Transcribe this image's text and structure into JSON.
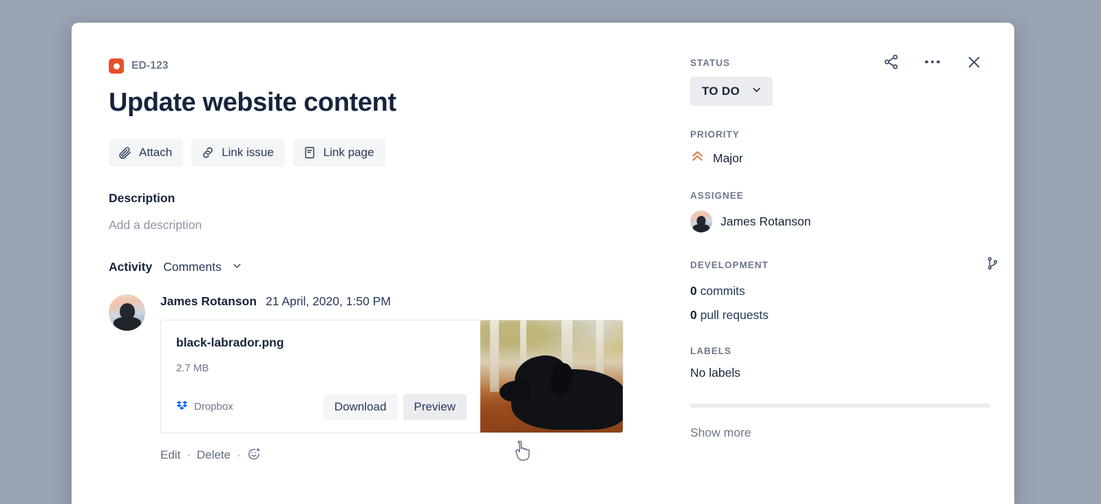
{
  "issue": {
    "key": "ED-123",
    "title": "Update website content",
    "project_icon": "project-square-icon",
    "accent_color": "#e8502a"
  },
  "top_actions": {
    "share_label": "share-icon",
    "more_label": "more-options-icon",
    "close_label": "close-icon"
  },
  "action_buttons": [
    {
      "label": "Attach",
      "icon": "paperclip-icon"
    },
    {
      "label": "Link issue",
      "icon": "link-icon"
    },
    {
      "label": "Link page",
      "icon": "page-icon"
    }
  ],
  "description": {
    "heading": "Description",
    "placeholder": "Add a description"
  },
  "activity": {
    "heading": "Activity",
    "tab_label": "Comments",
    "chevron": "chevron-down-icon"
  },
  "comment": {
    "author": "James Rotanson",
    "timestamp": "21 April, 2020, 1:50 PM",
    "actions": {
      "edit": "Edit",
      "separator": "·",
      "delete": "Delete",
      "emoji": "add-reaction-icon"
    },
    "attachment": {
      "filename": "black-labrador.png",
      "size": "2.7 MB",
      "source": "Dropbox",
      "source_icon": "dropbox-icon",
      "source_color": "#0061fe",
      "download_label": "Download",
      "preview_label": "Preview",
      "thumbnail_alt": "black labrador dog lying in autumn leaves"
    }
  },
  "sidebar": {
    "status": {
      "label": "STATUS",
      "value": "TO DO",
      "chevron": "chevron-down-icon"
    },
    "priority": {
      "label": "PRIORITY",
      "value": "Major",
      "icon": "priority-major-icon",
      "icon_color": "#d97440"
    },
    "assignee": {
      "label": "ASSIGNEE",
      "value": "James Rotanson",
      "avatar": "user-avatar"
    },
    "development": {
      "label": "DEVELOPMENT",
      "branch_icon": "git-branch-icon",
      "commits_count": "0",
      "commits_label": "commits",
      "pull_requests_count": "0",
      "pull_requests_label": "pull requests"
    },
    "labels": {
      "label": "LABELS",
      "value": "No labels"
    },
    "show_more": "Show more"
  }
}
